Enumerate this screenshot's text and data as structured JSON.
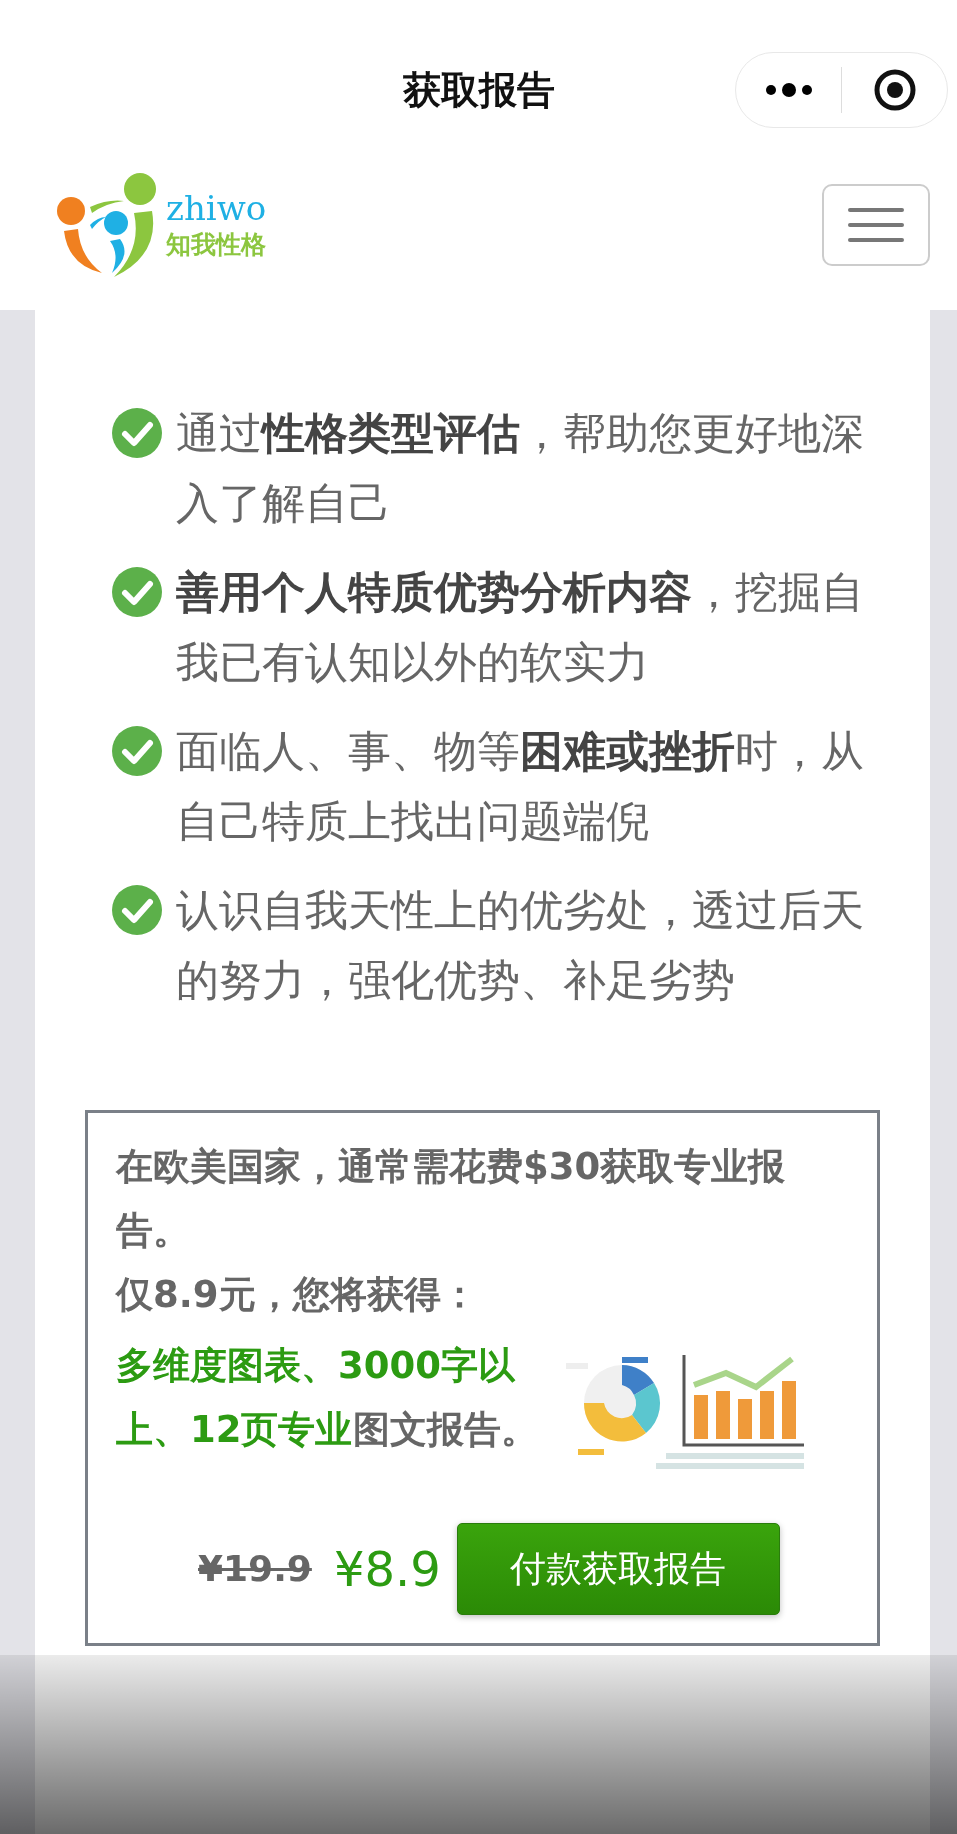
{
  "nav_bar": {
    "title": "获取报告"
  },
  "site_header": {
    "logo_name": "zhiwo",
    "logo_tagline": "知我性格"
  },
  "benefits": [
    {
      "text": "通过**性格类型评估**，帮助您更好地深入了解自己"
    },
    {
      "text": "**善用个人特质优势分析内容**，挖掘自我已有认知以外的软实力"
    },
    {
      "text": "面临人、事、物等**困难或挫折**时，从自己特质上找出问题端倪"
    },
    {
      "text": "认识自我天性上的优劣处，透过后天的努力，强化优势、补足劣势"
    }
  ],
  "offer": {
    "intro": "在欧美国家，通常需花费$30获取专业报告。",
    "subheading": "仅8.9元，您将获得：",
    "features_highlight": "多维度图表、3000字以上、12页专业",
    "features_rest": "图文报告。",
    "original_price": "¥19.9",
    "price": "¥8.9",
    "pay_button": "付款获取报告"
  }
}
